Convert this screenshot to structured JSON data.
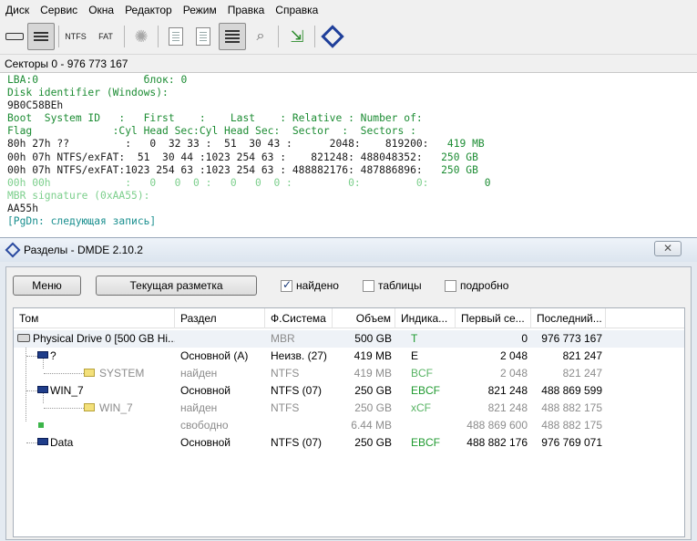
{
  "menu": [
    "Диск",
    "Сервис",
    "Окна",
    "Редактор",
    "Режим",
    "Правка",
    "Справка"
  ],
  "toolbar": {
    "ntfs_label": "NTFS",
    "fat_label": "FAT"
  },
  "sector_header": "Секторы 0 - 976 773 167",
  "hex": {
    "lba_label": "LBA:",
    "lba_value": "0",
    "block_label": "блок:",
    "block_value": "0",
    "disk_id_label": "Disk identifier (Windows):",
    "disk_id_value": "9B0C58BEh",
    "hdr1": "Boot  System ID   :   First    :    Last    : Relative : Number of:",
    "hdr2": "Flag             :Cyl Head Sec:Cyl Head Sec:  Sector  :  Sectors :",
    "entries": [
      {
        "main": "80h 27h ??         :   0  32 33 :  51  30 43 :      2048:    819200:",
        "size": "   419 MB",
        "dim": false
      },
      {
        "main": "00h 07h NTFS/exFAT:  51  30 44 :1023 254 63 :    821248: 488048352:",
        "size": "   250 GB",
        "dim": false
      },
      {
        "main": "00h 07h NTFS/exFAT:1023 254 63 :1023 254 63 : 488882176: 487886896:",
        "size": "   250 GB",
        "dim": false
      },
      {
        "main": "00h 00h            :   0   0  0 :   0   0  0 :         0:         0:",
        "size": "         0",
        "dim": true
      }
    ],
    "mbr_sig_label": "MBR signature (0xAA55):",
    "mbr_sig_value": "AA55h",
    "pgdn": "[PgDn: следующая запись]"
  },
  "partitions_window": {
    "title": "Разделы - DMDE 2.10.2",
    "close_symbol": "✕",
    "menu_button": "Меню",
    "layout_button": "Текущая разметка",
    "found_checkbox": {
      "label": "найдено",
      "checked": true
    },
    "tables_checkbox": {
      "label": "таблицы",
      "checked": false
    },
    "verbose_checkbox": {
      "label": "подробно",
      "checked": false
    },
    "columns": [
      "Том",
      "Раздел",
      "Ф.Система",
      "Объем",
      "Индика...",
      "Первый се...",
      "Последний..."
    ],
    "rows": [
      {
        "name": "Physical Drive 0 [500 GB Hi...",
        "part": "",
        "fs": "MBR",
        "size": "500 GB",
        "ind": "T",
        "first": "0",
        "last": "976 773 167"
      },
      {
        "name": "?",
        "part": "Основной (A)",
        "fs": "Неизв. (27)",
        "size": "419 MB",
        "ind": "E",
        "first": "2 048",
        "last": "821 247"
      },
      {
        "name": "SYSTEM",
        "part": "найден",
        "fs": "NTFS",
        "size": "419 MB",
        "ind": "BCF",
        "first": "2 048",
        "last": "821 247"
      },
      {
        "name": "WIN_7",
        "part": "Основной",
        "fs": "NTFS (07)",
        "size": "250 GB",
        "ind": "EBCF",
        "first": "821 248",
        "last": "488 869 599"
      },
      {
        "name": "WIN_7",
        "part": "найден",
        "fs": "NTFS",
        "size": "250 GB",
        "ind": "xCF",
        "first": "821 248",
        "last": "488 882 175"
      },
      {
        "name": "",
        "part": "свободно",
        "fs": "",
        "size": "6.44 MB",
        "ind": "",
        "first": "488 869 600",
        "last": "488 882 175"
      },
      {
        "name": "Data",
        "part": "Основной",
        "fs": "NTFS (07)",
        "size": "250 GB",
        "ind": "EBCF",
        "first": "488 882 176",
        "last": "976 769 071"
      }
    ]
  }
}
